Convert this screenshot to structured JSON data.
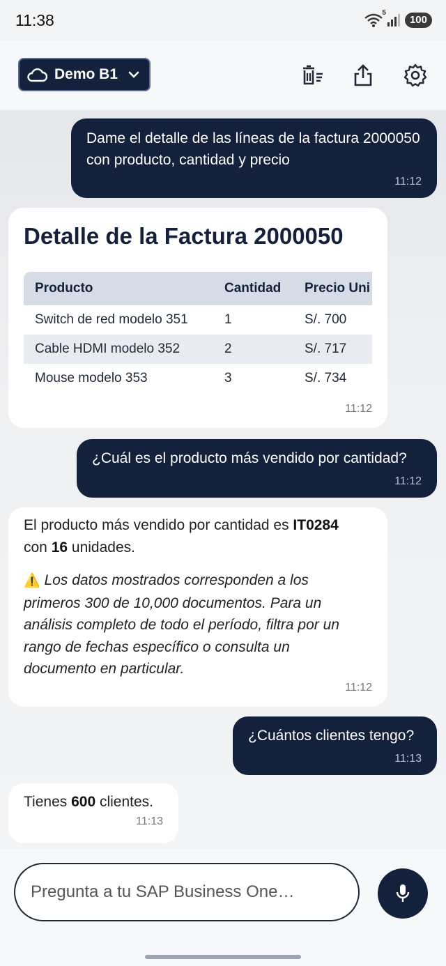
{
  "status": {
    "time": "11:38",
    "battery": "100",
    "signal_badge": "5"
  },
  "header": {
    "instance_label": "Demo B1",
    "icons": [
      "cloud-icon",
      "chevron-down-icon",
      "clear-chat-icon",
      "share-icon",
      "settings-icon"
    ]
  },
  "messages": [
    {
      "role": "user",
      "text": "Dame el detalle de las líneas de la factura 2000050 con producto, cantidad y precio",
      "time": "11:12"
    },
    {
      "role": "assistant",
      "title": "Detalle de la Factura 2000050",
      "table": {
        "headers": [
          "Producto",
          "Cantidad",
          "Precio Uni"
        ],
        "rows": [
          [
            "Switch de red modelo 351",
            "1",
            "S/. 700"
          ],
          [
            "Cable HDMI modelo 352",
            "2",
            "S/. 717"
          ],
          [
            "Mouse modelo 353",
            "3",
            "S/. 734"
          ]
        ]
      },
      "time": "11:12"
    },
    {
      "role": "user",
      "text": "¿Cuál es el producto más vendido por cantidad?",
      "time": "11:12"
    },
    {
      "role": "assistant",
      "text_prefix": "El producto más vendido por cantidad es ",
      "product": "IT0284",
      "text_mid": "con ",
      "count": "16",
      "text_suffix": " unidades.",
      "warning_emoji": "⚠️",
      "warning": "Los datos mostrados corresponden a los primeros 300 de 10,000 documentos. Para un análisis completo de todo el período, filtra por un rango de fechas específico o consulta un documento en particular.",
      "time": "11:12"
    },
    {
      "role": "user",
      "text": "¿Cuántos clientes tengo?",
      "time": "11:13"
    },
    {
      "role": "assistant",
      "text_prefix": "Tienes ",
      "count": "600",
      "text_suffix": " clientes.",
      "time": "11:13"
    }
  ],
  "input": {
    "placeholder": "Pregunta a tu SAP Business One…"
  },
  "colors": {
    "primary": "#14213d",
    "background": "#f3f4f6",
    "table_header": "#d6dce5",
    "row_alt": "#e8ecf1"
  }
}
